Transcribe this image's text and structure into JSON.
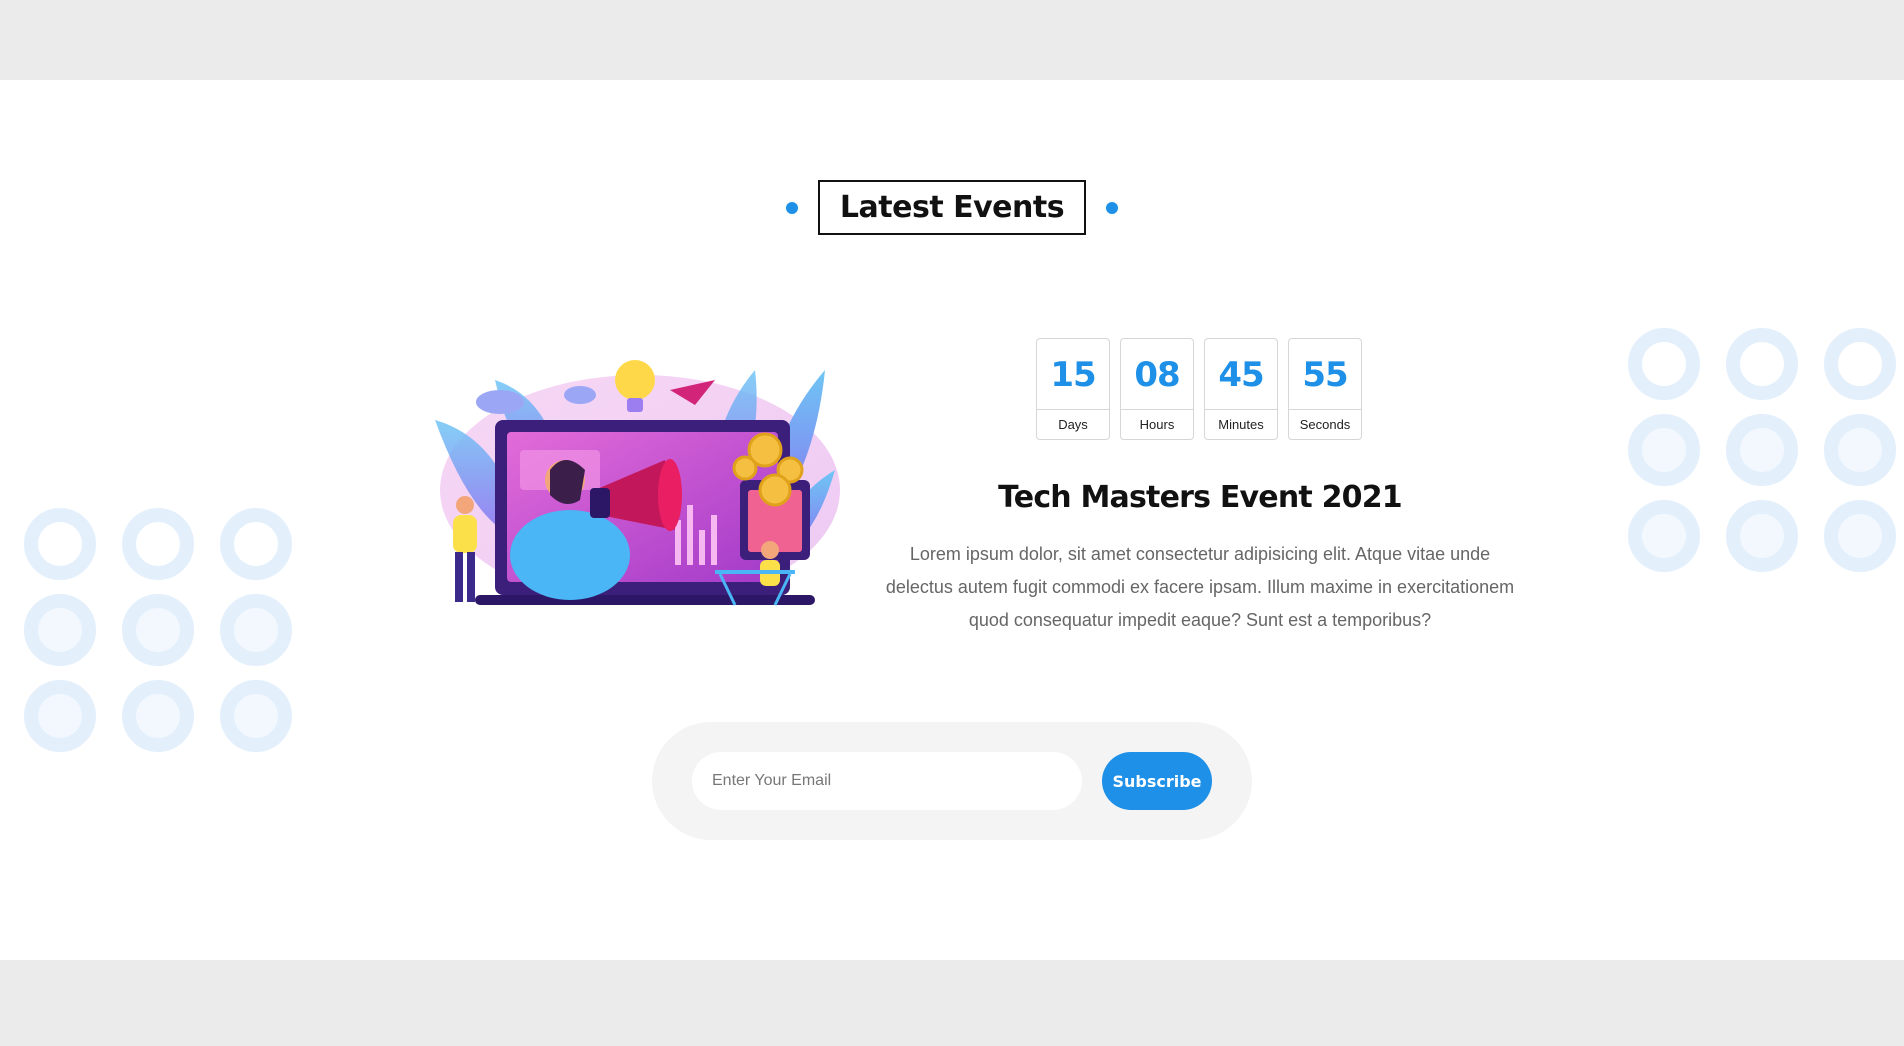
{
  "heading": "Latest Events",
  "countdown": [
    {
      "value": "15",
      "label": "Days"
    },
    {
      "value": "08",
      "label": "Hours"
    },
    {
      "value": "45",
      "label": "Minutes"
    },
    {
      "value": "55",
      "label": "Seconds"
    }
  ],
  "event": {
    "title": "Tech Masters Event 2021",
    "description": "Lorem ipsum dolor, sit amet consectetur adipisicing elit. Atque vitae unde delectus autem fugit commodi ex facere ipsam. Illum maxime in exercitationem quod consequatur impedit eaque? Sunt est a temporibus?"
  },
  "subscribe": {
    "email_placeholder": "Enter Your Email",
    "button_label": "Subscribe"
  },
  "colors": {
    "accent": "#1e90e8",
    "decor": "#e3f0fc"
  },
  "illustration": {
    "icon": "marketing-megaphone-illustration"
  }
}
